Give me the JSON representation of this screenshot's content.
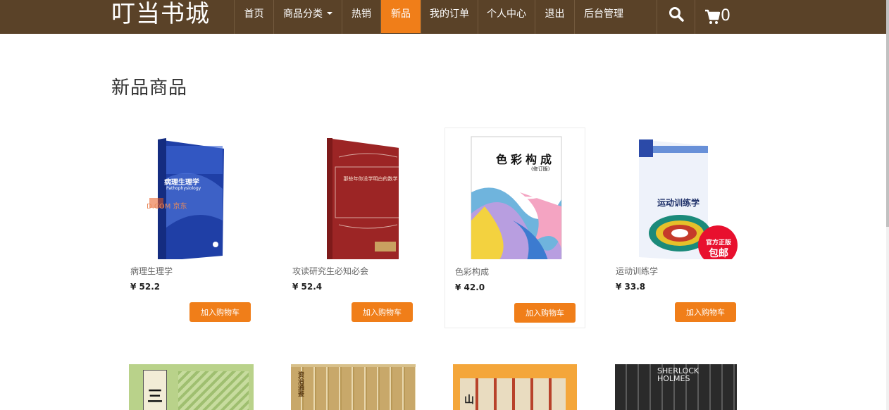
{
  "navbar": {
    "brand": "叮当书城",
    "items": [
      {
        "label": "首页",
        "active": false
      },
      {
        "label": "商品分类",
        "active": false,
        "has_dropdown": true
      },
      {
        "label": "热销",
        "active": false
      },
      {
        "label": "新品",
        "active": true
      },
      {
        "label": "我的订单",
        "active": false
      },
      {
        "label": "个人中心",
        "active": false
      },
      {
        "label": "退出",
        "active": false
      },
      {
        "label": "后台管理",
        "active": false
      }
    ],
    "search_icon": "search-icon",
    "cart_icon": "cart-icon",
    "cart_count": "0",
    "colors": {
      "bar": "#5a4228",
      "accent": "#f07e19"
    }
  },
  "main": {
    "title": "新品商品",
    "products": [
      {
        "name": "病理生理学",
        "price": "¥ 52.2",
        "button": "加入购物车",
        "cover_title": "病理生理学",
        "cover_subtitle": "Pathophysiology",
        "cover_watermark": "D.COM 京东"
      },
      {
        "name": "攻读研究生必知必会",
        "price": "¥ 52.4",
        "button": "加入购物车",
        "cover_title": "那些年你没学明白的数学"
      },
      {
        "name": "色彩构成",
        "price": "¥ 42.0",
        "button": "加入购物车",
        "cover_title": "色彩构成",
        "cover_subtitle": "(修订版)"
      },
      {
        "name": "运动训练学",
        "price": "¥ 33.8",
        "button": "加入购物车",
        "cover_title": "运动训练学",
        "cover_badge_line1": "官方正版",
        "cover_badge_line2": "包邮"
      }
    ],
    "second_row": [
      {
        "cover_text": "三"
      },
      {
        "cover_text": "资治通鉴"
      },
      {
        "cover_text": "山"
      },
      {
        "cover_text": "SHERLOCK HOLMES"
      }
    ]
  }
}
